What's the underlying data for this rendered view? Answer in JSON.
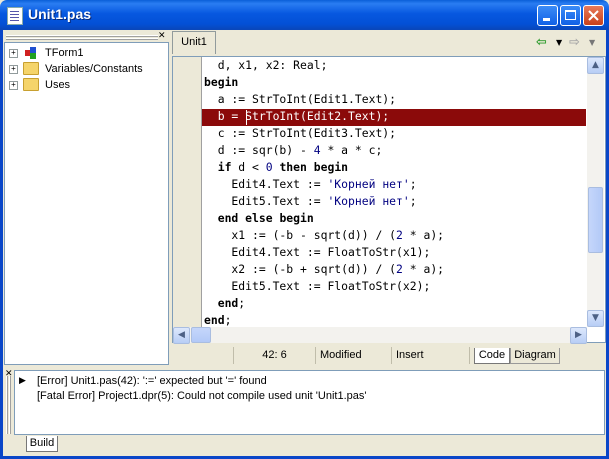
{
  "window": {
    "title": "Unit1.pas"
  },
  "tree": {
    "items": [
      {
        "label": "TForm1",
        "icon": "form-component-icon"
      },
      {
        "label": "Variables/Constants",
        "icon": "folder-icon"
      },
      {
        "label": "Uses",
        "icon": "folder-icon"
      }
    ]
  },
  "editor": {
    "tab": "Unit1",
    "code": [
      "  d, x1, x2: Real;",
      "begin",
      "  a := StrToInt(Edit1.Text);",
      "  b = StrToInt(Edit2.Text);",
      "  c := StrToInt(Edit3.Text);",
      "  d := sqr(b) - 4 * a * c;",
      "  if d < 0 then begin",
      "    Edit4.Text := 'Корней нет';",
      "    Edit5.Text := 'Корней нет';",
      "  end else begin",
      "    x1 := (-b - sqrt(d)) / (2 * a);",
      "    Edit4.Text := FloatToStr(x1);",
      "    x2 := (-b + sqrt(d)) / (2 * a);",
      "    Edit5.Text := FloatToStr(x2);",
      "  end;",
      "end;"
    ],
    "error_line_index": 3
  },
  "status": {
    "position": "42:  6",
    "modified": "Modified",
    "mode": "Insert",
    "tabs": [
      "Code",
      "Diagram"
    ]
  },
  "messages": {
    "items": [
      "[Error] Unit1.pas(42): ':=' expected but '=' found",
      "[Fatal Error] Project1.dpr(5): Could not compile used unit 'Unit1.pas'"
    ],
    "tab": "Build"
  },
  "colors": {
    "error_line_bg": "#8b0a0a",
    "title_bar": "#0758e0"
  }
}
